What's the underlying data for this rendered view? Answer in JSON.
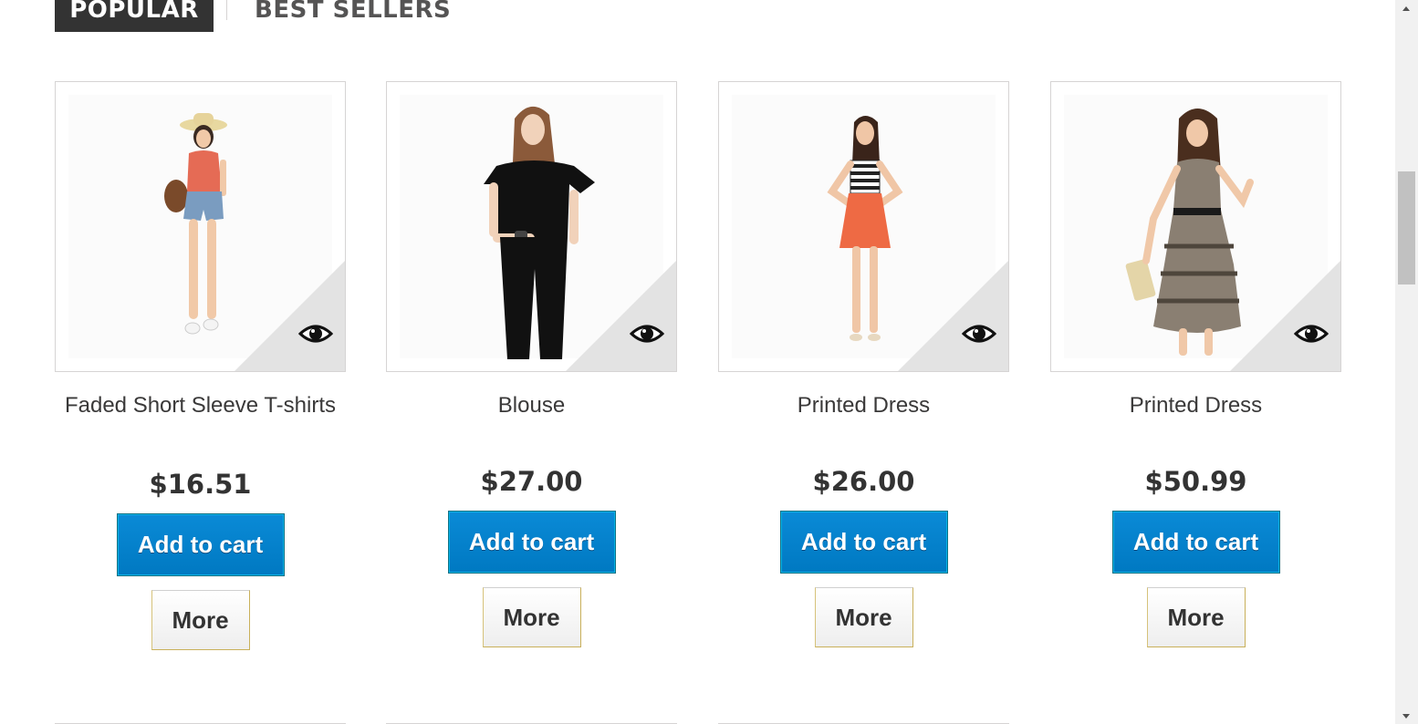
{
  "tabs": {
    "popular_label": "POPULAR",
    "bestsellers_label": "BEST SELLERS",
    "active": "POPULAR"
  },
  "products": [
    {
      "name": "Faded Short Sleeve T-shirts",
      "price": "$16.51",
      "add_to_cart_label": "Add to cart",
      "more_label": "More",
      "quick_view_icon": "eye-icon"
    },
    {
      "name": "Blouse",
      "price": "$27.00",
      "add_to_cart_label": "Add to cart",
      "more_label": "More",
      "quick_view_icon": "eye-icon"
    },
    {
      "name": "Printed Dress",
      "price": "$26.00",
      "add_to_cart_label": "Add to cart",
      "more_label": "More",
      "quick_view_icon": "eye-icon"
    },
    {
      "name": "Printed Dress",
      "price": "$50.99",
      "add_to_cart_label": "Add to cart",
      "more_label": "More",
      "quick_view_icon": "eye-icon"
    }
  ],
  "colors": {
    "active_tab_bg": "#333333",
    "cart_button": "#0079c2",
    "price_text": "#333333"
  }
}
